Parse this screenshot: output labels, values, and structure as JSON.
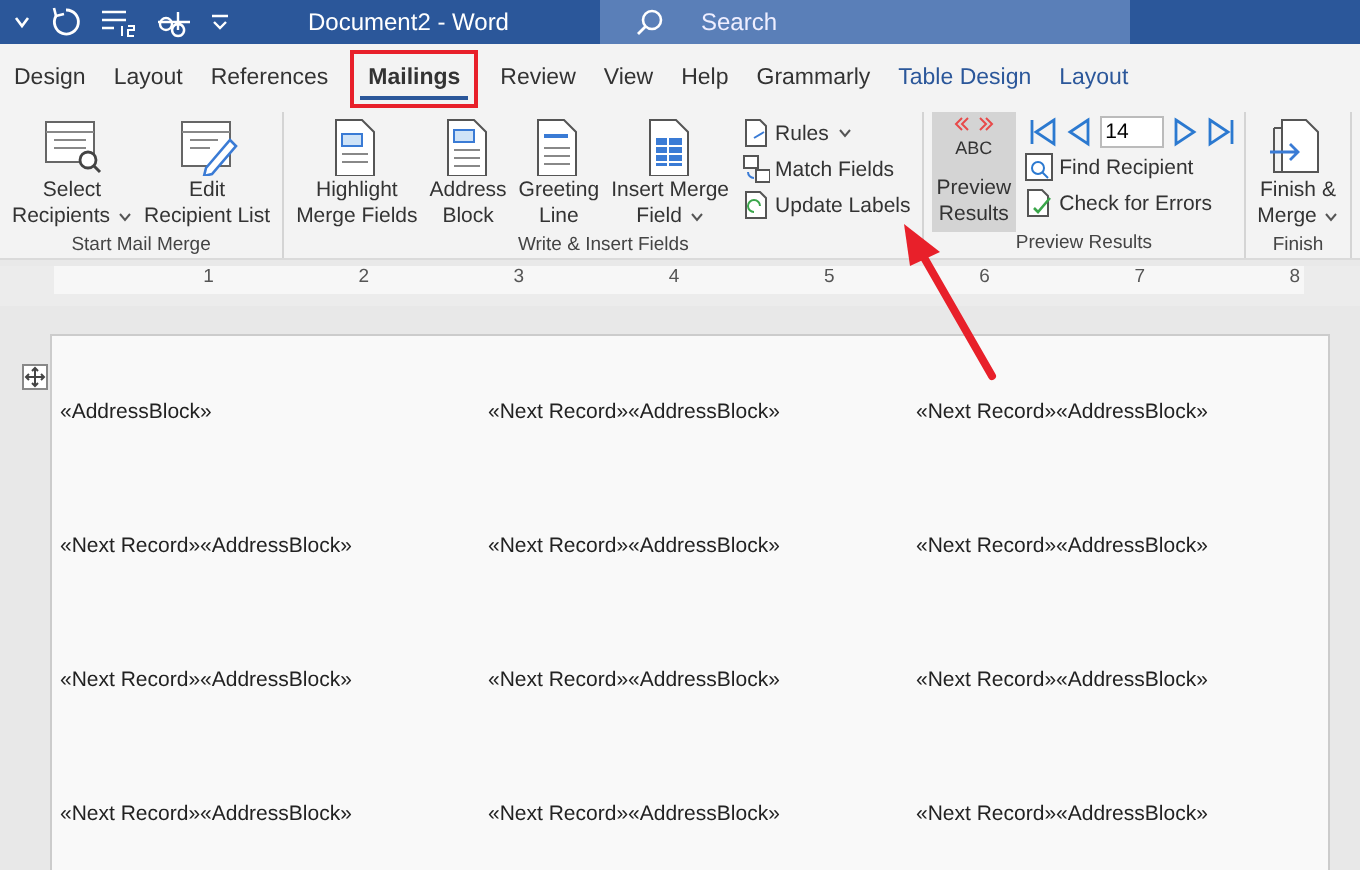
{
  "title_bar": {
    "title": "Document2 - Word",
    "search": {
      "placeholder": "Search"
    }
  },
  "tabs": [
    {
      "label": "Design",
      "selected": false,
      "kind": "normal"
    },
    {
      "label": "Layout",
      "selected": false,
      "kind": "normal"
    },
    {
      "label": "References",
      "selected": false,
      "kind": "normal"
    },
    {
      "label": "Mailings",
      "selected": true,
      "kind": "normal"
    },
    {
      "label": "Review",
      "selected": false,
      "kind": "normal"
    },
    {
      "label": "View",
      "selected": false,
      "kind": "normal"
    },
    {
      "label": "Help",
      "selected": false,
      "kind": "normal"
    },
    {
      "label": "Grammarly",
      "selected": false,
      "kind": "normal"
    },
    {
      "label": "Table Design",
      "selected": false,
      "kind": "contextual"
    },
    {
      "label": "Layout",
      "selected": false,
      "kind": "contextual"
    }
  ],
  "ribbon_groups": [
    {
      "label": "Start Mail Merge",
      "items": [
        {
          "kind": "large",
          "lines": [
            "Select",
            "Recipients"
          ],
          "dropdown": true,
          "selected": false
        },
        {
          "kind": "large",
          "lines": [
            "Edit",
            "Recipient List"
          ],
          "dropdown": false,
          "selected": false
        }
      ]
    },
    {
      "label": "Write & Insert Fields",
      "items": [
        {
          "kind": "large",
          "lines": [
            "Highlight",
            "Merge Fields"
          ],
          "dropdown": false,
          "selected": false
        },
        {
          "kind": "large",
          "lines": [
            "Address",
            "Block"
          ],
          "dropdown": false,
          "selected": false
        },
        {
          "kind": "large",
          "lines": [
            "Greeting",
            "Line"
          ],
          "dropdown": false,
          "selected": false
        },
        {
          "kind": "large",
          "lines": [
            "Insert Merge",
            "Field"
          ],
          "dropdown": true,
          "selected": false
        },
        {
          "kind": "stack",
          "buttons": [
            {
              "label": "Rules",
              "dropdown": true
            },
            {
              "label": "Match Fields",
              "dropdown": false
            },
            {
              "label": "Update Labels",
              "dropdown": false
            }
          ]
        }
      ]
    },
    {
      "label": "Preview Results",
      "items": [
        {
          "kind": "large",
          "icon_text": "ABC",
          "lines": [
            "Preview",
            "Results"
          ],
          "dropdown": false,
          "selected": true
        },
        {
          "kind": "nav",
          "record": "14",
          "buttons": [
            {
              "label": "Find Recipient",
              "dropdown": false
            },
            {
              "label": "Check for Errors",
              "dropdown": false
            }
          ]
        }
      ]
    },
    {
      "label": "Finish",
      "items": [
        {
          "kind": "large",
          "lines": [
            "Finish &",
            "Merge"
          ],
          "dropdown": true,
          "selected": false
        }
      ]
    }
  ],
  "ruler": {
    "marks": [
      "1",
      "2",
      "3",
      "4",
      "5",
      "6",
      "7",
      "8"
    ]
  },
  "labels": [
    [
      "«AddressBlock»",
      "«Next Record»«AddressBlock»",
      "«Next Record»«AddressBlock»"
    ],
    [
      "«Next Record»«AddressBlock»",
      "«Next Record»«AddressBlock»",
      "«Next Record»«AddressBlock»"
    ],
    [
      "«Next Record»«AddressBlock»",
      "«Next Record»«AddressBlock»",
      "«Next Record»«AddressBlock»"
    ],
    [
      "«Next Record»«AddressBlock»",
      "«Next Record»«AddressBlock»",
      "«Next Record»«AddressBlock»"
    ]
  ]
}
